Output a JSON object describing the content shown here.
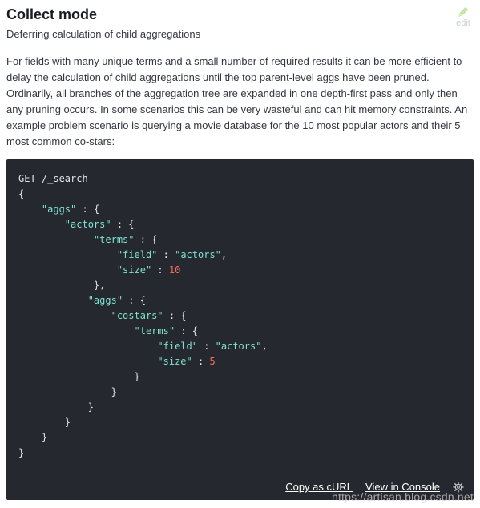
{
  "section": {
    "title": "Collect mode",
    "subtitle": "Deferring calculation of child aggregations",
    "edit_label": "edit",
    "paragraph": "For fields with many unique terms and a small number of required results it can be more efficient to delay the calculation of child aggregations until the top parent-level aggs have been pruned. Ordinarily, all branches of the aggregation tree are expanded in one depth-first pass and only then any pruning occurs. In some scenarios this can be very wasteful and can hit memory constraints. An example problem scenario is querying a movie database for the 10 most popular actors and their 5 most common co-stars:"
  },
  "code": {
    "request_line": "GET /_search",
    "keys": {
      "aggs": "\"aggs\"",
      "actors": "\"actors\"",
      "terms": "\"terms\"",
      "field": "\"field\"",
      "size": "\"size\"",
      "costars": "\"costars\""
    },
    "values": {
      "field_actors": "\"actors\"",
      "size_10": "10",
      "size_5": "5"
    }
  },
  "footer": {
    "copy_curl": "Copy as cURL",
    "view_console": "View in Console",
    "settings_icon": "gear-icon"
  },
  "watermark": "https://artisan.blog.csdn.net",
  "colors": {
    "code_bg": "#25282f",
    "key": "#7de2d1",
    "number": "#f66e5a",
    "edit": "#cbd2d9",
    "pencil": "#c7e9a0"
  }
}
